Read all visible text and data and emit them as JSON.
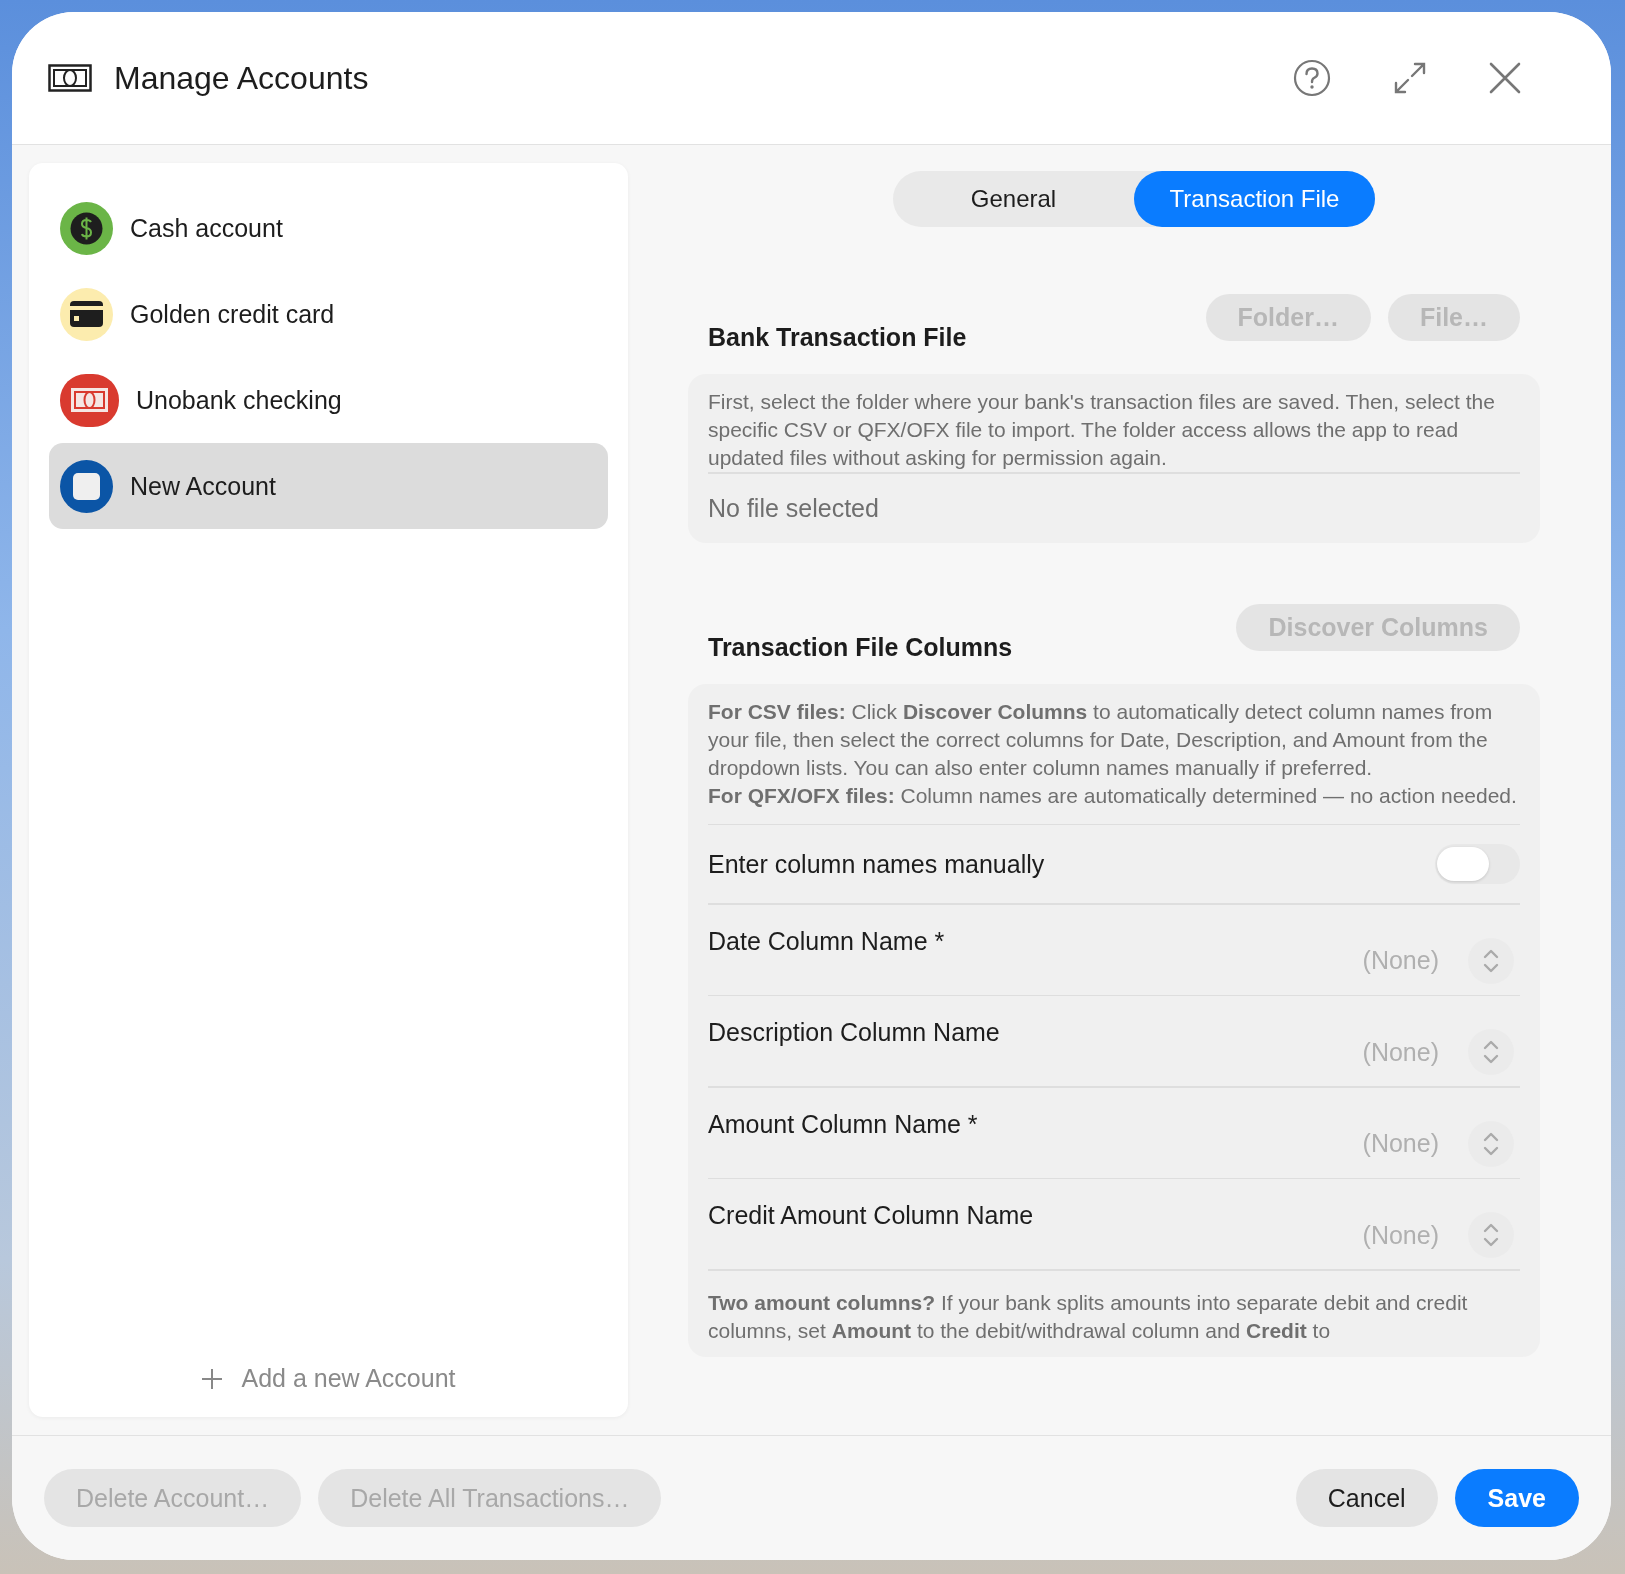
{
  "window": {
    "title": "Manage Accounts"
  },
  "sidebar": {
    "items": [
      {
        "name": "Cash account",
        "kind": "cash",
        "color": "#6bb547",
        "selected": false
      },
      {
        "name": "Golden credit card",
        "kind": "card",
        "color": "#fcecae",
        "selected": false
      },
      {
        "name": "Unobank checking",
        "kind": "bank",
        "color": "#d93a2f",
        "selected": false
      },
      {
        "name": "New Account",
        "kind": "blank",
        "color": "#0b55a6",
        "selected": true
      }
    ],
    "add_label": "Add a new Account"
  },
  "tabs": [
    {
      "label": "General",
      "selected": false
    },
    {
      "label": "Transaction File",
      "selected": true
    }
  ],
  "bank_file": {
    "title": "Bank Transaction File",
    "buttons": [
      {
        "label": "Folder…",
        "disabled": true
      },
      {
        "label": "File…",
        "disabled": true
      }
    ],
    "description": "First, select the folder where your bank's transaction files are saved. Then, select the specific CSV or QFX/OFX file to import. The folder access allows the app to read updated files without asking for permission again.",
    "status": "No file selected"
  },
  "columns": {
    "title": "Transaction File Columns",
    "button": {
      "label": "Discover Columns",
      "disabled": true
    },
    "help": [
      "**For CSV files:** Click **Discover Columns** to automatically detect column names from your file, then select the correct columns for Date, Description, and Amount from the dropdown lists. You can also enter column names manually if preferred.",
      "**For QFX/OFX files:** Column names are automatically determined — no action needed."
    ],
    "manual_toggle": {
      "label": "Enter column names manually",
      "on": false
    },
    "fields": [
      {
        "label": "Date Column Name *",
        "value": "(None)"
      },
      {
        "label": "Description Column Name",
        "value": "(None)"
      },
      {
        "label": "Amount Column Name *",
        "value": "(None)"
      },
      {
        "label": "Credit Amount Column Name",
        "value": "(None)"
      }
    ],
    "note": "**Two amount columns?** If your bank splits amounts into separate debit and credit columns, set **Amount** to the debit/withdrawal column and **Credit** to"
  },
  "footer": {
    "left_buttons": [
      {
        "label": "Delete Account…",
        "disabled": true,
        "primary": false
      },
      {
        "label": "Delete All Transactions…",
        "disabled": true,
        "primary": false
      }
    ],
    "right_buttons": [
      {
        "label": "Cancel",
        "disabled": false,
        "primary": false
      },
      {
        "label": "Save",
        "disabled": false,
        "primary": true
      }
    ]
  }
}
